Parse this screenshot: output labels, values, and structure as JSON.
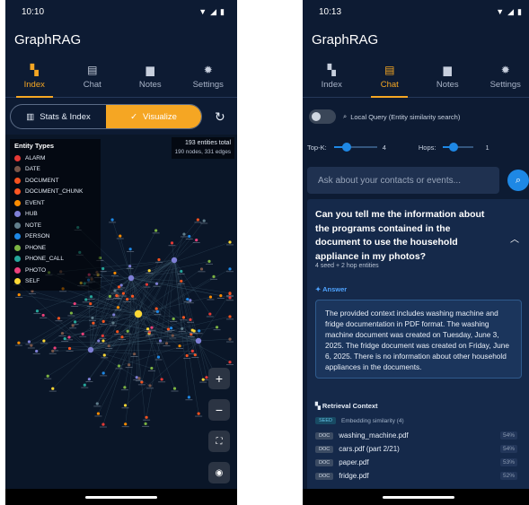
{
  "screen1": {
    "status": {
      "time": "10:10"
    },
    "app_title": "GraphRAG",
    "tabs": [
      {
        "label": "Index",
        "icon": "hierarchy-icon",
        "active": true
      },
      {
        "label": "Chat",
        "icon": "chat-icon",
        "active": false
      },
      {
        "label": "Notes",
        "icon": "note-icon",
        "active": false
      },
      {
        "label": "Settings",
        "icon": "gear-icon",
        "active": false
      }
    ],
    "segment": {
      "stats_label": "Stats & Index",
      "visualize_label": "Visualize",
      "selected": "Visualize"
    },
    "legend": {
      "title": "Entity Types",
      "items": [
        {
          "label": "ALARM",
          "color": "#e53935"
        },
        {
          "label": "DATE",
          "color": "#795548"
        },
        {
          "label": "DOCUMENT",
          "color": "#f4511e"
        },
        {
          "label": "DOCUMENT_CHUNK",
          "color": "#ff5722"
        },
        {
          "label": "EVENT",
          "color": "#fb8c00"
        },
        {
          "label": "HUB",
          "color": "#7e7fd6"
        },
        {
          "label": "NOTE",
          "color": "#607d8b"
        },
        {
          "label": "PERSON",
          "color": "#1e88e5"
        },
        {
          "label": "PHONE",
          "color": "#7cb342"
        },
        {
          "label": "PHONE_CALL",
          "color": "#26a69a"
        },
        {
          "label": "PHOTO",
          "color": "#ec407a"
        },
        {
          "label": "SELF",
          "color": "#fdd835"
        }
      ]
    },
    "stats": {
      "entities": "193 entities total",
      "nodes_edges": "190 nodes, 331 edges"
    },
    "zoom": {
      "in": "+",
      "out": "−"
    }
  },
  "screen2": {
    "status": {
      "time": "10:13"
    },
    "app_title": "GraphRAG",
    "tabs": [
      {
        "label": "Index",
        "icon": "hierarchy-icon",
        "active": false
      },
      {
        "label": "Chat",
        "icon": "chat-icon",
        "active": true
      },
      {
        "label": "Notes",
        "icon": "note-icon",
        "active": false
      },
      {
        "label": "Settings",
        "icon": "gear-icon",
        "active": false
      }
    ],
    "local_query": {
      "label": "Local Query (Entity similarity search)",
      "enabled": false
    },
    "topk": {
      "label": "Top-K:",
      "value": "4",
      "fraction": 0.3
    },
    "hops": {
      "label": "Hops:",
      "value": "1",
      "fraction": 0.35
    },
    "search": {
      "placeholder": "Ask about your contacts or events..."
    },
    "question": "Can you tell me the information about the programs contained in the document to use the household appliance in my photos?",
    "question_meta": "4 seed + 2 hop entities",
    "answer_label": "Answer",
    "answer": "The provided context includes washing machine and fridge documentation in PDF format. The washing machine document was created on Tuesday, June 3, 2025. The fridge document was created on Friday, June 6, 2025. There is no information about other household appliances in the documents.",
    "retrieval": {
      "label": "Retrieval Context",
      "seed_badge": "SEED",
      "seed_text": "Embedding similarity (4)",
      "doc_badge": "DOC",
      "docs": [
        {
          "name": "washing_machine.pdf",
          "score": "54%"
        },
        {
          "name": "cars.pdf (part 2/21)",
          "score": "54%"
        },
        {
          "name": "paper.pdf",
          "score": "53%"
        },
        {
          "name": "fridge.pdf",
          "score": "52%"
        }
      ]
    }
  }
}
